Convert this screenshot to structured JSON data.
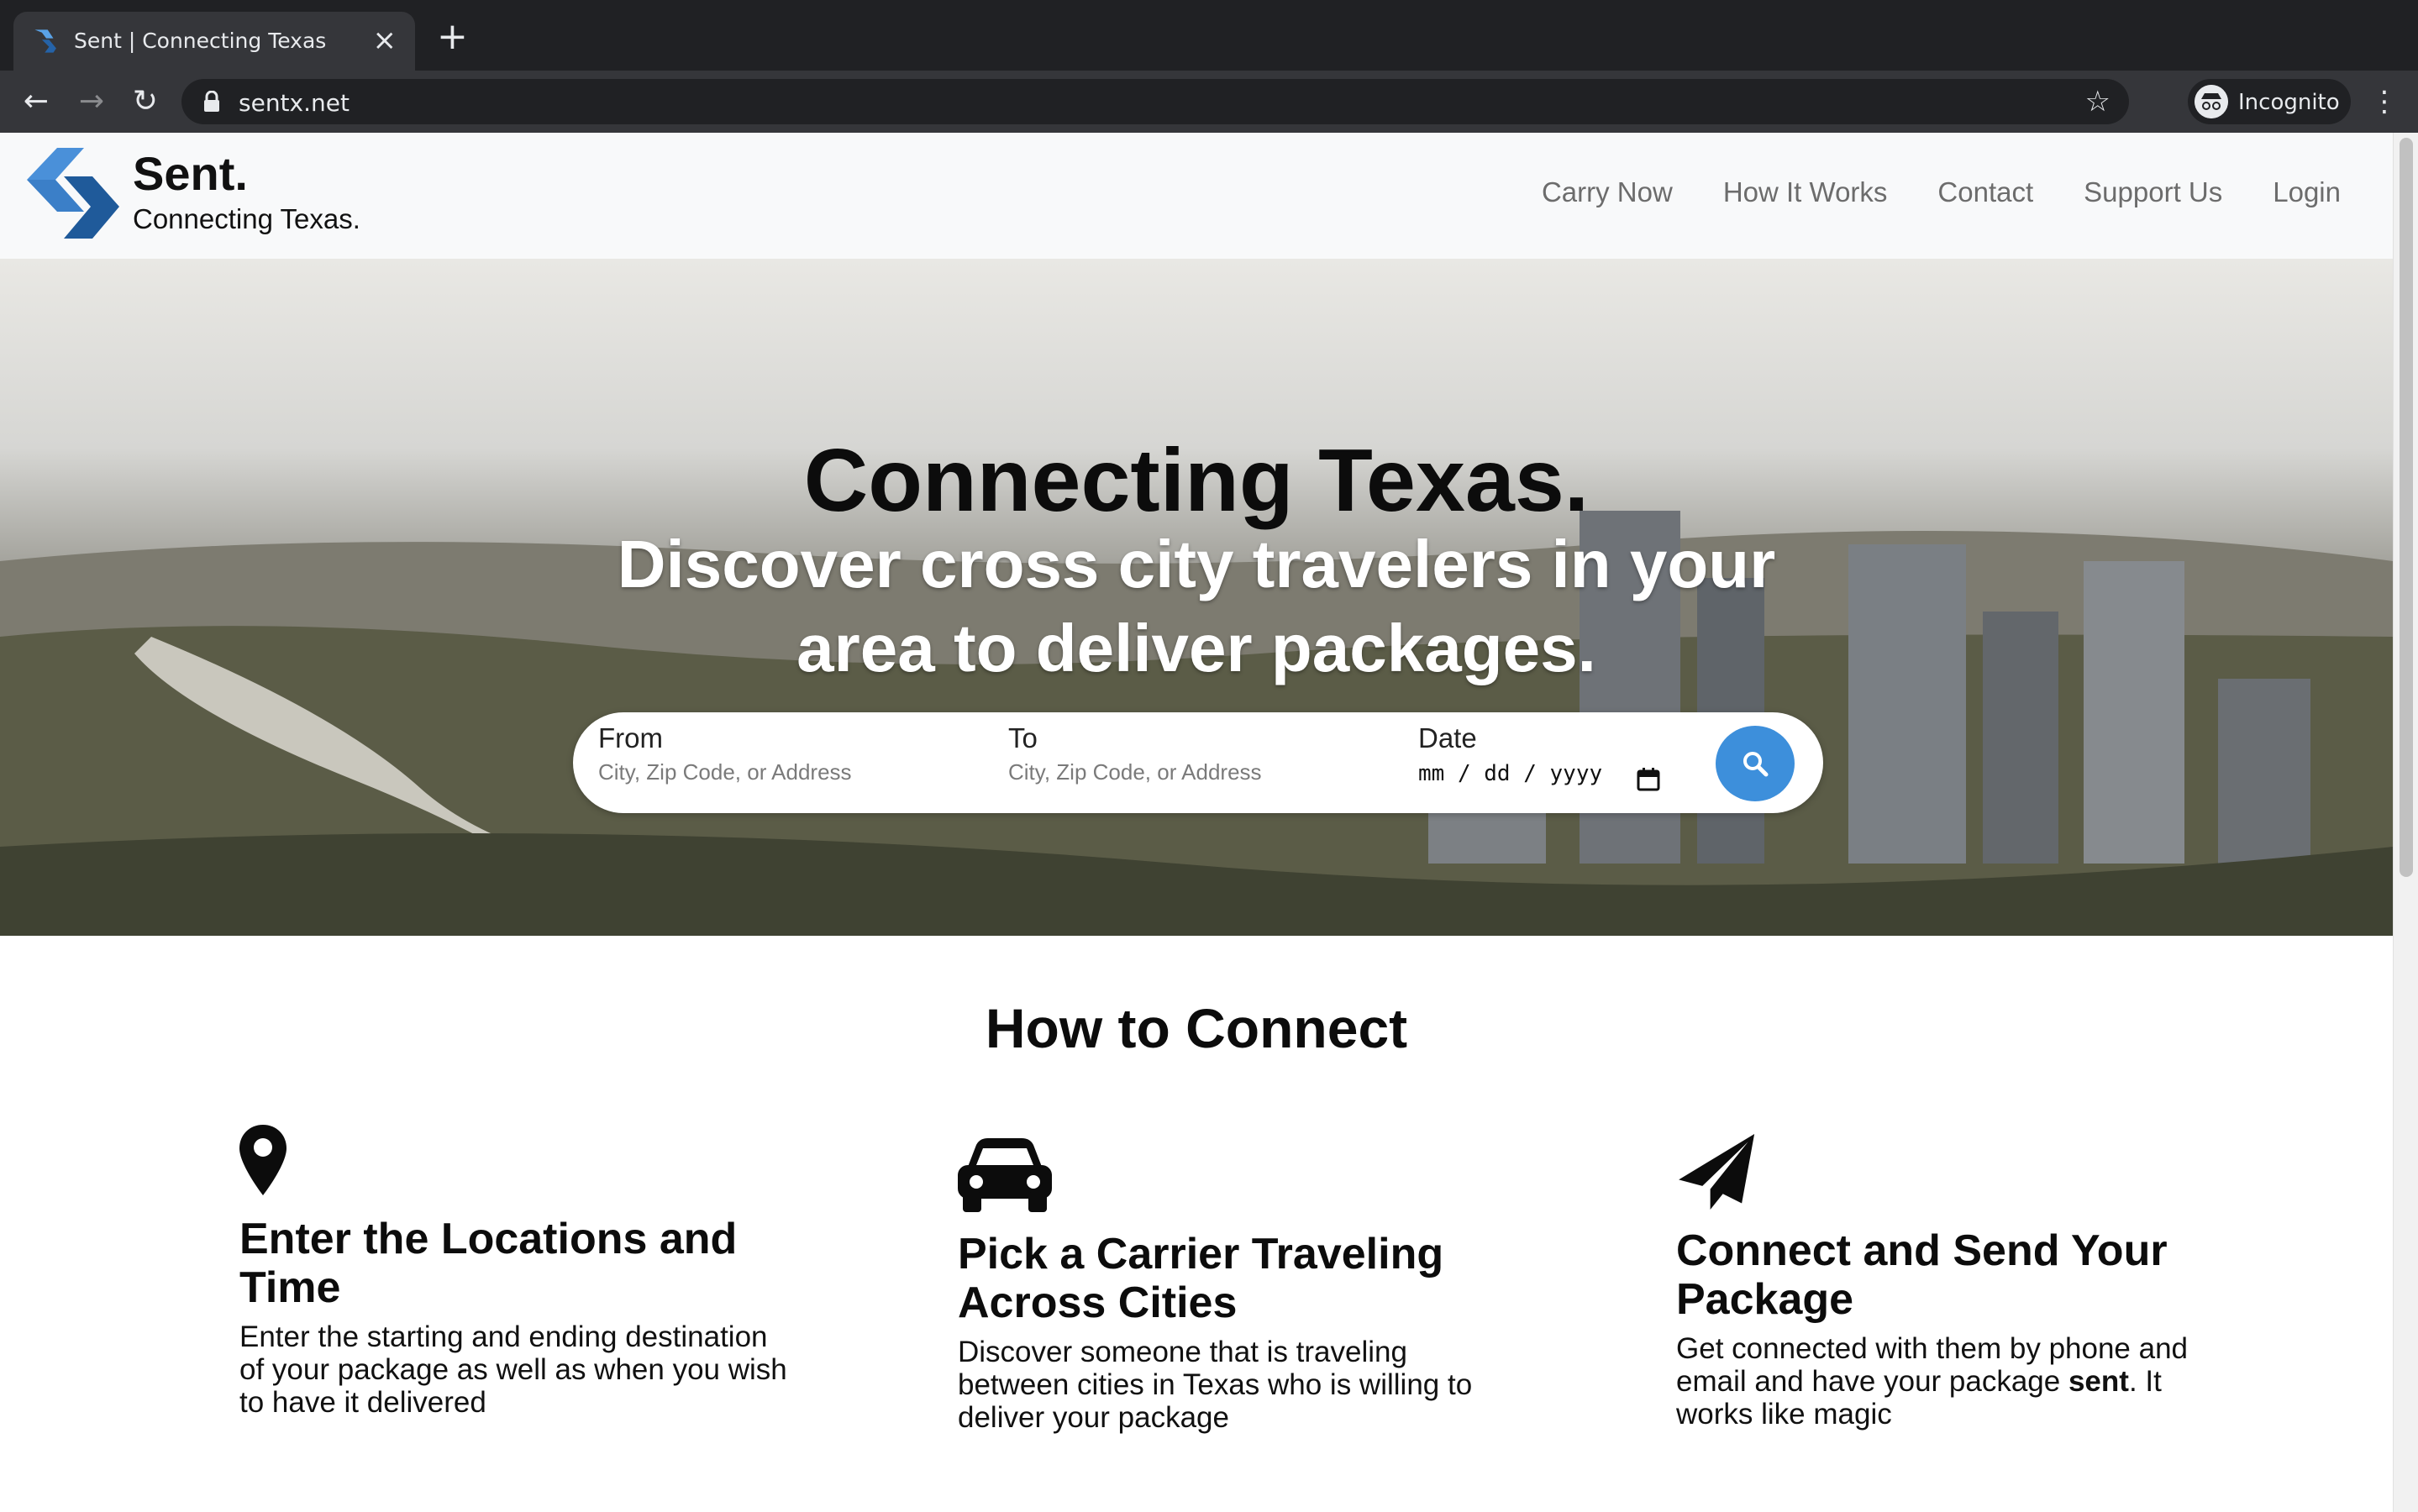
{
  "browser": {
    "tab_title": "Sent | Connecting Texas",
    "url": "sentx.net",
    "profile_label": "Incognito"
  },
  "site": {
    "brand": "Sent.",
    "tagline": "Connecting Texas.",
    "nav": [
      "Carry Now",
      "How It Works",
      "Contact",
      "Support Us",
      "Login"
    ],
    "accent_color": "#3d8fdb"
  },
  "hero": {
    "title": "Connecting Texas.",
    "subtitle": "Discover cross city travelers in your area to deliver packages."
  },
  "search": {
    "from_label": "From",
    "from_placeholder": "City, Zip Code, or Address",
    "to_label": "To",
    "to_placeholder": "City, Zip Code, or Address",
    "date_label": "Date",
    "date_value": "mm / dd / yyyy"
  },
  "how": {
    "title": "How to Connect",
    "steps": [
      {
        "icon": "map-pin-icon",
        "title": "Enter the Locations and Time",
        "desc": "Enter the starting and ending destination of your package as well as when you wish to have it delivered"
      },
      {
        "icon": "car-icon",
        "title": "Pick a Carrier Traveling Across Cities",
        "desc": "Discover someone that is traveling between cities in Texas who is willing to deliver your package"
      },
      {
        "icon": "paper-plane-icon",
        "title": "Connect and Send Your Package",
        "desc_prefix": "Get connected with them by phone and email and have your package ",
        "desc_bold": "sent",
        "desc_suffix": ". It works like magic"
      }
    ]
  }
}
